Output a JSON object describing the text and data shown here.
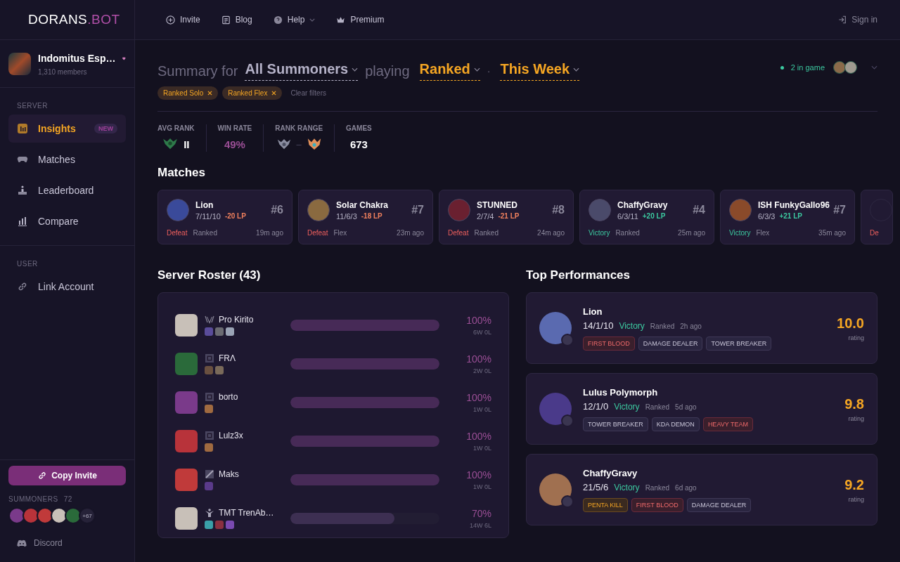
{
  "logo": {
    "part_1": "DORANS",
    "part_2": ".BOT"
  },
  "nav": [
    {
      "label": "Invite",
      "kind": "plus",
      "caret": false
    },
    {
      "label": "Blog",
      "kind": "doc",
      "caret": false
    },
    {
      "label": "Help",
      "kind": "help",
      "caret": true
    },
    {
      "label": "Premium",
      "kind": "crown",
      "caret": false
    }
  ],
  "sign_in": "Sign in",
  "server": {
    "name": "Indomitus Esp…",
    "members": "1,310 members",
    "favorite": true
  },
  "sidebar": [
    {
      "heading": "SERVER",
      "items": [
        {
          "label": "Insights",
          "selected": true,
          "badge": "NEW"
        },
        {
          "label": "Matches",
          "selected": false
        },
        {
          "label": "Leaderboard",
          "selected": false
        },
        {
          "label": "Compare",
          "selected": false
        }
      ]
    },
    {
      "heading": "USER",
      "items": [
        {
          "label": "Link Account",
          "selected": false
        }
      ]
    }
  ],
  "copy_invite": "Copy Invite",
  "summoners": {
    "label": "SUMMONERS",
    "count": "72",
    "more": "+67"
  },
  "discord": "Discord",
  "summary": {
    "prefix": "Summary for",
    "who": "All Summoners",
    "mid": "playing",
    "queue": "Ranked",
    "sep": "·",
    "period": "This Week"
  },
  "filters": [
    {
      "label": "Ranked Solo"
    },
    {
      "label": "Ranked Flex"
    }
  ],
  "clear_filters": "Clear filters",
  "in_game": "2 in game",
  "stats": [
    {
      "label": "AVG RANK",
      "kind": "rank",
      "value": "II"
    },
    {
      "label": "WIN RATE",
      "kind": "percent",
      "value": "49%"
    },
    {
      "label": "RANK RANGE",
      "kind": "range",
      "value": "–"
    },
    {
      "label": "GAMES",
      "kind": "number",
      "value": "673"
    }
  ],
  "matches": {
    "heading": "Matches",
    "items": [
      {
        "name": "Lion",
        "kda": "7/11/10",
        "lp": "-20 LP",
        "result": "Defeat",
        "won": false,
        "queue": "Ranked",
        "time": "19m ago",
        "place": "#6"
      },
      {
        "name": "Solar Chakra",
        "kda": "11/6/3",
        "lp": "-18 LP",
        "result": "Defeat",
        "won": false,
        "queue": "Flex",
        "time": "23m ago",
        "place": "#7"
      },
      {
        "name": "STUNNED",
        "kda": "2/7/4",
        "lp": "-21 LP",
        "result": "Defeat",
        "won": false,
        "queue": "Ranked",
        "time": "24m ago",
        "place": "#8"
      },
      {
        "name": "ChaffyGravy",
        "kda": "6/3/11",
        "lp": "+20 LP",
        "result": "Victory",
        "won": true,
        "queue": "Ranked",
        "time": "25m ago",
        "place": "#4"
      },
      {
        "name": "ISH FunkyGallo96",
        "kda": "6/3/3",
        "lp": "+21 LP",
        "result": "Victory",
        "won": true,
        "queue": "Flex",
        "time": "35m ago",
        "place": "#7"
      }
    ],
    "partial": {
      "result": "De",
      "won": false
    }
  },
  "roster": {
    "heading": "Server Roster (43)",
    "rows": [
      {
        "name": "Pro Kirito",
        "kind": "wings",
        "champions": [
          {
            "color": "#5a4c9a"
          },
          {
            "color": "#6b6b72"
          },
          {
            "color": "#9aa3b5"
          }
        ],
        "level": 1,
        "pct": "100%",
        "record": "6W 0L"
      },
      {
        "name": "FRΛ",
        "kind": "frame",
        "champions": [
          {
            "color": "#6a5040"
          },
          {
            "color": "#7a6a5a"
          }
        ],
        "level": 1,
        "pct": "100%",
        "record": "2W 0L"
      },
      {
        "name": "borto",
        "kind": "frame",
        "champions": [
          {
            "color": "#a06a40"
          }
        ],
        "level": 1,
        "pct": "100%",
        "record": "1W 0L"
      },
      {
        "name": "Lulz3x",
        "kind": "frame",
        "champions": [
          {
            "color": "#a06a40"
          }
        ],
        "level": 1,
        "pct": "100%",
        "record": "1W 0L"
      },
      {
        "name": "Maks",
        "kind": "slash",
        "champions": [
          {
            "color": "#5a3a8a"
          }
        ],
        "level": 1,
        "pct": "100%",
        "record": "1W 0L"
      },
      {
        "name": "TMT TrenAb…",
        "kind": "figure",
        "champions": [
          {
            "color": "#3aa0a8"
          },
          {
            "color": "#8a3040"
          },
          {
            "color": "#7a4ab0"
          }
        ],
        "level": 0.7,
        "pct": "70%",
        "record": "14W 6L"
      }
    ]
  },
  "top": {
    "heading": "Top Performances",
    "items": [
      {
        "name": "Lion",
        "kda": "14/1/10",
        "result": "Victory",
        "queue": "Ranked",
        "time": "2h ago",
        "rating": "10.0",
        "rating_label": "rating",
        "tags": [
          {
            "label": "FIRST BLOOD",
            "kind": "red"
          },
          {
            "label": "DAMAGE DEALER",
            "kind": "gray"
          },
          {
            "label": "TOWER BREAKER",
            "kind": "gray"
          }
        ]
      },
      {
        "name": "Lulus Polymorph",
        "kda": "12/1/0",
        "result": "Victory",
        "queue": "Ranked",
        "time": "5d ago",
        "rating": "9.8",
        "rating_label": "rating",
        "tags": [
          {
            "label": "TOWER BREAKER",
            "kind": "gray"
          },
          {
            "label": "KDA DEMON",
            "kind": "gray"
          },
          {
            "label": "HEAVY TEAM",
            "kind": "red"
          }
        ]
      },
      {
        "name": "ChaffyGravy",
        "kda": "21/5/6",
        "result": "Victory",
        "queue": "Ranked",
        "time": "6d ago",
        "rating": "9.2",
        "rating_label": "rating",
        "tags": [
          {
            "label": "PENTA KILL",
            "kind": "gold"
          },
          {
            "label": "FIRST BLOOD",
            "kind": "red"
          },
          {
            "label": "DAMAGE DEALER",
            "kind": "gray"
          }
        ]
      }
    ]
  }
}
